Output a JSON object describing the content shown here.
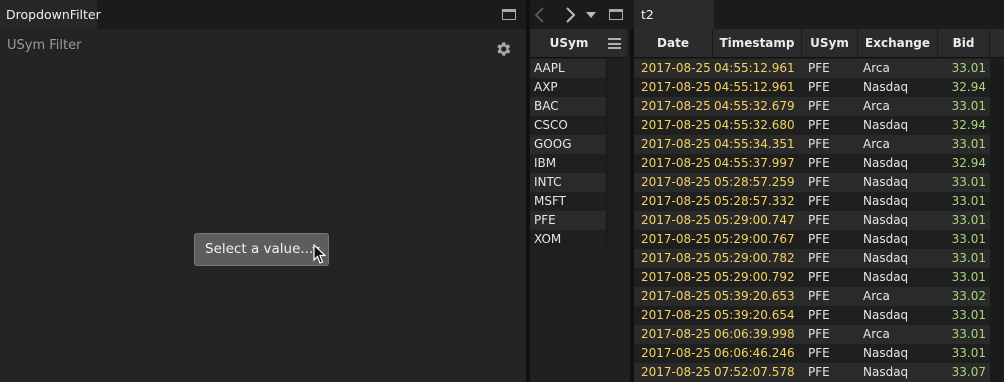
{
  "left_panel": {
    "tab_label": "DropdownFilter",
    "filter_title": "USym Filter",
    "select_label": "Select a value..."
  },
  "right_tabs": {
    "active_tab": "t2"
  },
  "usym_list": {
    "header": "USym",
    "items": [
      "AAPL",
      "AXP",
      "BAC",
      "CSCO",
      "GOOG",
      "IBM",
      "INTC",
      "MSFT",
      "PFE",
      "XOM"
    ]
  },
  "table": {
    "columns": [
      "Date",
      "Timestamp",
      "USym",
      "Exchange",
      "Bid"
    ],
    "rows": [
      [
        "2017-08-25",
        "04:55:12.961",
        "PFE",
        "Arca",
        "33.01"
      ],
      [
        "2017-08-25",
        "04:55:12.961",
        "PFE",
        "Nasdaq",
        "32.94"
      ],
      [
        "2017-08-25",
        "04:55:32.679",
        "PFE",
        "Arca",
        "33.01"
      ],
      [
        "2017-08-25",
        "04:55:32.680",
        "PFE",
        "Nasdaq",
        "32.94"
      ],
      [
        "2017-08-25",
        "04:55:34.351",
        "PFE",
        "Arca",
        "33.01"
      ],
      [
        "2017-08-25",
        "04:55:37.997",
        "PFE",
        "Nasdaq",
        "32.94"
      ],
      [
        "2017-08-25",
        "05:28:57.259",
        "PFE",
        "Nasdaq",
        "33.01"
      ],
      [
        "2017-08-25",
        "05:28:57.332",
        "PFE",
        "Nasdaq",
        "33.01"
      ],
      [
        "2017-08-25",
        "05:29:00.747",
        "PFE",
        "Nasdaq",
        "33.01"
      ],
      [
        "2017-08-25",
        "05:29:00.767",
        "PFE",
        "Nasdaq",
        "33.01"
      ],
      [
        "2017-08-25",
        "05:29:00.782",
        "PFE",
        "Nasdaq",
        "33.01"
      ],
      [
        "2017-08-25",
        "05:29:00.792",
        "PFE",
        "Nasdaq",
        "33.01"
      ],
      [
        "2017-08-25",
        "05:39:20.653",
        "PFE",
        "Arca",
        "33.02"
      ],
      [
        "2017-08-25",
        "05:39:20.654",
        "PFE",
        "Nasdaq",
        "33.01"
      ],
      [
        "2017-08-25",
        "06:06:39.998",
        "PFE",
        "Arca",
        "33.01"
      ],
      [
        "2017-08-25",
        "06:06:46.246",
        "PFE",
        "Nasdaq",
        "33.01"
      ],
      [
        "2017-08-25",
        "07:52:07.578",
        "PFE",
        "Nasdaq",
        "33.07"
      ]
    ]
  },
  "icons": {
    "gear": "gear-icon",
    "maximize": "maximize-icon",
    "back": "chevron-left-icon",
    "forward": "chevron-right-icon",
    "tab_list": "caret-down-icon",
    "column_menu": "hamburger-menu-icon",
    "cursor": "mouse-pointer-icon"
  },
  "colors": {
    "date_time_text": "#f4d35e",
    "bid_text": "#a8d77b",
    "row_even": "#2a2a2a",
    "row_odd": "#1f1f1f"
  }
}
